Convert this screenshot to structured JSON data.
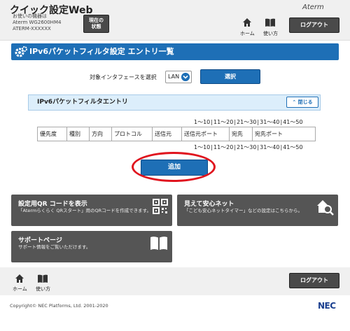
{
  "header": {
    "app_title": "クイック設定Web",
    "device_label": "お使いの機器は",
    "device_model": "Aterm WG2600HM4",
    "device_id": "ATERM-XXXXXX",
    "status_button": "現在の\n状態",
    "brand": "Aterm",
    "home_label": "ホーム",
    "manual_label": "使い方",
    "logout_label": "ログアウト"
  },
  "page": {
    "title": "IPv6パケットフィルタ設定 エントリ一覧"
  },
  "interface_select": {
    "label": "対象インタフェースを選択",
    "value": "LAN",
    "button": "選択"
  },
  "panel": {
    "title": "IPv6パケットフィルタエントリ",
    "close_label": "閉じる"
  },
  "pager": [
    "1～10",
    "11～20",
    "21～30",
    "31～40",
    "41～50"
  ],
  "table": {
    "headers": [
      "優先度",
      "種別",
      "方向",
      "プロトコル",
      "送信元",
      "送信元ポート",
      "宛先",
      "宛先ポート"
    ]
  },
  "add_button": "追加",
  "cards": {
    "qr": {
      "title": "設定用QR コードを表示",
      "desc": "「Atermらくらく QRスタート」用のQRコードを作成できます。"
    },
    "safety": {
      "title": "見えて安心ネット",
      "desc": "「こども安心ネットタイマー」などの設定はこちらから。"
    },
    "support": {
      "title": "サポートページ",
      "desc": "サポート情報をご覧いただけます。"
    }
  },
  "footer": {
    "home_label": "ホーム",
    "manual_label": "使い方",
    "logout_label": "ログアウト",
    "copyright": "Copyright© NEC Platforms, Ltd. 2001-2020",
    "logo": "NEC"
  }
}
